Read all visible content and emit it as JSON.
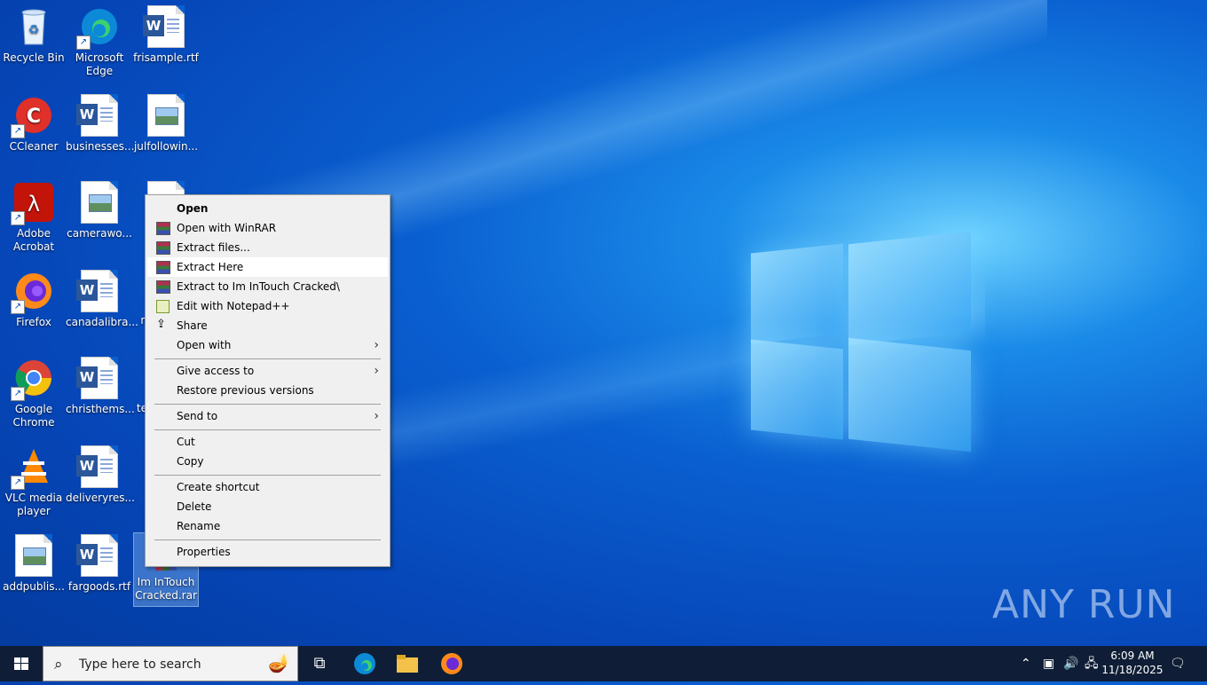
{
  "desktop_icons": [
    {
      "label": "Recycle Bin",
      "icon": "recycle-bin-icon"
    },
    {
      "label": "Microsoft Edge",
      "icon": "edge-icon"
    },
    {
      "label": "frisample.rtf",
      "icon": "word-doc-icon"
    },
    {
      "label": "CCleaner",
      "icon": "ccleaner-icon"
    },
    {
      "label": "businesses...",
      "icon": "word-doc-icon"
    },
    {
      "label": "julfollowin...",
      "icon": "image-doc-icon"
    },
    {
      "label": "Adobe Acrobat",
      "icon": "acrobat-icon"
    },
    {
      "label": "camerawo...",
      "icon": "image-doc-icon"
    },
    {
      "label": "ju",
      "icon": "image-doc-icon"
    },
    {
      "label": "Firefox",
      "icon": "firefox-icon"
    },
    {
      "label": "canadalibra...",
      "icon": "word-doc-icon"
    },
    {
      "label": "n",
      "icon": "doc-icon"
    },
    {
      "label": "Google Chrome",
      "icon": "chrome-icon"
    },
    {
      "label": "christhems...",
      "icon": "word-doc-icon"
    },
    {
      "label": "te",
      "icon": "doc-icon"
    },
    {
      "label": "VLC media player",
      "icon": "vlc-icon"
    },
    {
      "label": "deliveryres...",
      "icon": "word-doc-icon"
    },
    {
      "label": "addpublis...",
      "icon": "image-doc-icon"
    },
    {
      "label": "fargoods.rtf",
      "icon": "word-doc-icon"
    },
    {
      "label": "Im InTouch Cracked.rar",
      "icon": "winrar-archive-icon"
    }
  ],
  "context_menu": {
    "items": [
      {
        "label": "Open",
        "bold": true
      },
      {
        "label": "Open with WinRAR",
        "icon": "winrar-icon"
      },
      {
        "label": "Extract files...",
        "icon": "winrar-icon"
      },
      {
        "label": "Extract Here",
        "icon": "winrar-icon",
        "highlighted": true
      },
      {
        "label": "Extract to Im InTouch Cracked\\",
        "icon": "winrar-icon"
      },
      {
        "label": "Edit with Notepad++",
        "icon": "notepadpp-icon"
      },
      {
        "label": "Share",
        "icon": "share-icon"
      },
      {
        "label": "Open with",
        "submenu": true
      },
      {
        "label": "Give access to",
        "submenu": true
      },
      {
        "label": "Restore previous versions"
      },
      {
        "label": "Send to",
        "submenu": true
      },
      {
        "label": "Cut"
      },
      {
        "label": "Copy"
      },
      {
        "label": "Create shortcut"
      },
      {
        "label": "Delete"
      },
      {
        "label": "Rename"
      },
      {
        "label": "Properties"
      }
    ]
  },
  "watermark": "ANY RUN",
  "taskbar": {
    "search_placeholder": "Type here to search",
    "time": "6:09 AM",
    "date": "11/18/2025"
  }
}
